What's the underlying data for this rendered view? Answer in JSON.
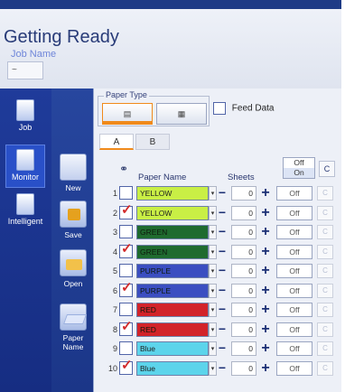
{
  "header": {
    "title": "Getting Ready",
    "job_name_label": "Job Name",
    "job_name_value": "~"
  },
  "left_nav": {
    "items": [
      {
        "label": "Job",
        "icon": "document-icon"
      },
      {
        "label": "Monitor",
        "icon": "monitor-icon"
      },
      {
        "label": "Intelligent",
        "icon": "intelligent-icon"
      }
    ]
  },
  "sub_nav": {
    "items": [
      {
        "label": "New",
        "icon": "new-icon"
      },
      {
        "label": "Save",
        "icon": "save-icon"
      },
      {
        "label": "Open",
        "icon": "open-icon"
      },
      {
        "label": "Paper Name",
        "icon": "paper-name-icon"
      }
    ]
  },
  "paper_type": {
    "legend": "Paper Type",
    "options": [
      "",
      ""
    ],
    "selected_index": 0
  },
  "feed_data": {
    "label": "Feed Data",
    "checked": false
  },
  "tabs": [
    {
      "label": "A",
      "active": true
    },
    {
      "label": "B",
      "active": false
    }
  ],
  "table": {
    "headers": {
      "paper_name": "Paper Name",
      "sheets": "Sheets",
      "toggle_off": "Off",
      "toggle_on": "On",
      "clear": "C"
    },
    "rows": [
      {
        "num": "1",
        "checked": false,
        "name": "YELLOW",
        "color": "#c9ef45",
        "sheets": "0",
        "toggle": "Off",
        "clear": "C"
      },
      {
        "num": "2",
        "checked": true,
        "name": "YELLOW",
        "color": "#c9ef45",
        "sheets": "0",
        "toggle": "Off",
        "clear": "C"
      },
      {
        "num": "3",
        "checked": false,
        "name": "GREEN",
        "color": "#1f6b2f",
        "sheets": "0",
        "toggle": "Off",
        "clear": "C"
      },
      {
        "num": "4",
        "checked": true,
        "name": "GREEN",
        "color": "#1f6b2f",
        "sheets": "0",
        "toggle": "Off",
        "clear": "C"
      },
      {
        "num": "5",
        "checked": false,
        "name": "PURPLE",
        "color": "#3b4ec1",
        "sheets": "0",
        "toggle": "Off",
        "clear": "C"
      },
      {
        "num": "6",
        "checked": true,
        "name": "PURPLE",
        "color": "#3b4ec1",
        "sheets": "0",
        "toggle": "Off",
        "clear": "C"
      },
      {
        "num": "7",
        "checked": false,
        "name": "RED",
        "color": "#d2232a",
        "sheets": "0",
        "toggle": "Off",
        "clear": "C"
      },
      {
        "num": "8",
        "checked": true,
        "name": "RED",
        "color": "#d2232a",
        "sheets": "0",
        "toggle": "Off",
        "clear": "C"
      },
      {
        "num": "9",
        "checked": false,
        "name": "Blue",
        "color": "#5cd4eb",
        "sheets": "0",
        "toggle": "Off",
        "clear": "C"
      },
      {
        "num": "10",
        "checked": true,
        "name": "Blue",
        "color": "#5cd4eb",
        "sheets": "0",
        "toggle": "Off",
        "clear": "C"
      }
    ]
  },
  "colors": {
    "accent": "#f08a1b",
    "nav_blue": "#1f3b9a",
    "title_blue": "#283b78"
  }
}
